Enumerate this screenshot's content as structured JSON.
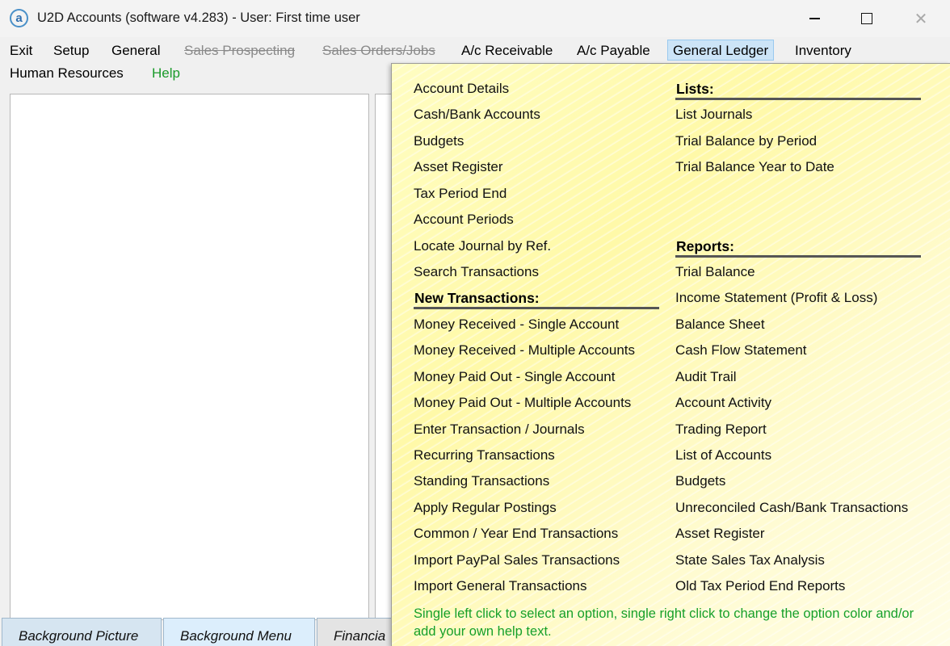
{
  "window": {
    "title": "U2D Accounts (software v4.283) -  User: First time user",
    "app_icon_glyph": "a"
  },
  "menubar": {
    "items": [
      {
        "label": "Exit",
        "state": "normal"
      },
      {
        "label": "Setup",
        "state": "normal"
      },
      {
        "label": "General",
        "state": "normal"
      },
      {
        "label": "Sales Prospecting",
        "state": "disabled"
      },
      {
        "label": "Sales Orders/Jobs",
        "state": "disabled"
      },
      {
        "label": "A/c Receivable",
        "state": "normal"
      },
      {
        "label": "A/c Payable",
        "state": "normal"
      },
      {
        "label": "General Ledger",
        "state": "active"
      },
      {
        "label": "Inventory",
        "state": "normal"
      },
      {
        "label": "Human Resources",
        "state": "normal"
      },
      {
        "label": "Help",
        "state": "help"
      }
    ]
  },
  "tabs": [
    "Background Picture",
    "Background Menu",
    "Financia"
  ],
  "dropdown": {
    "left_column": [
      "Account Details",
      "Cash/Bank Accounts",
      "Budgets",
      "Asset Register",
      "Tax Period End",
      "Account Periods",
      "Locate Journal by Ref.",
      "Search Transactions"
    ],
    "new_transactions_header": "New Transactions:",
    "new_transactions": [
      "Money Received - Single Account",
      "Money Received - Multiple Accounts",
      "Money Paid Out - Single Account",
      "Money Paid Out - Multiple Accounts",
      "Enter Transaction / Journals",
      "Recurring Transactions",
      "Standing Transactions",
      "Apply Regular Postings",
      "Common / Year End Transactions",
      "Import PayPal Sales Transactions",
      "Import General Transactions"
    ],
    "lists_header": "Lists:",
    "lists": [
      "List Journals",
      "Trial Balance by Period",
      "Trial Balance Year to Date"
    ],
    "reports_header": "Reports:",
    "reports": [
      "Trial Balance",
      "Income Statement (Profit & Loss)",
      "Balance Sheet",
      "Cash Flow Statement",
      "Audit Trail",
      "Account Activity",
      "Trading Report",
      "List of Accounts",
      "Budgets",
      "Unreconciled Cash/Bank Transactions",
      "Asset Register",
      "State Sales Tax Analysis",
      "Old Tax Period End Reports"
    ],
    "hint": "Single left click to select an option, single right click to change the option color and/or add your own help text."
  },
  "colors": {
    "help_green": "#1a9a2a",
    "menu_active_bg": "#cce4f7",
    "dropdown_bg": "#fff9a8"
  }
}
